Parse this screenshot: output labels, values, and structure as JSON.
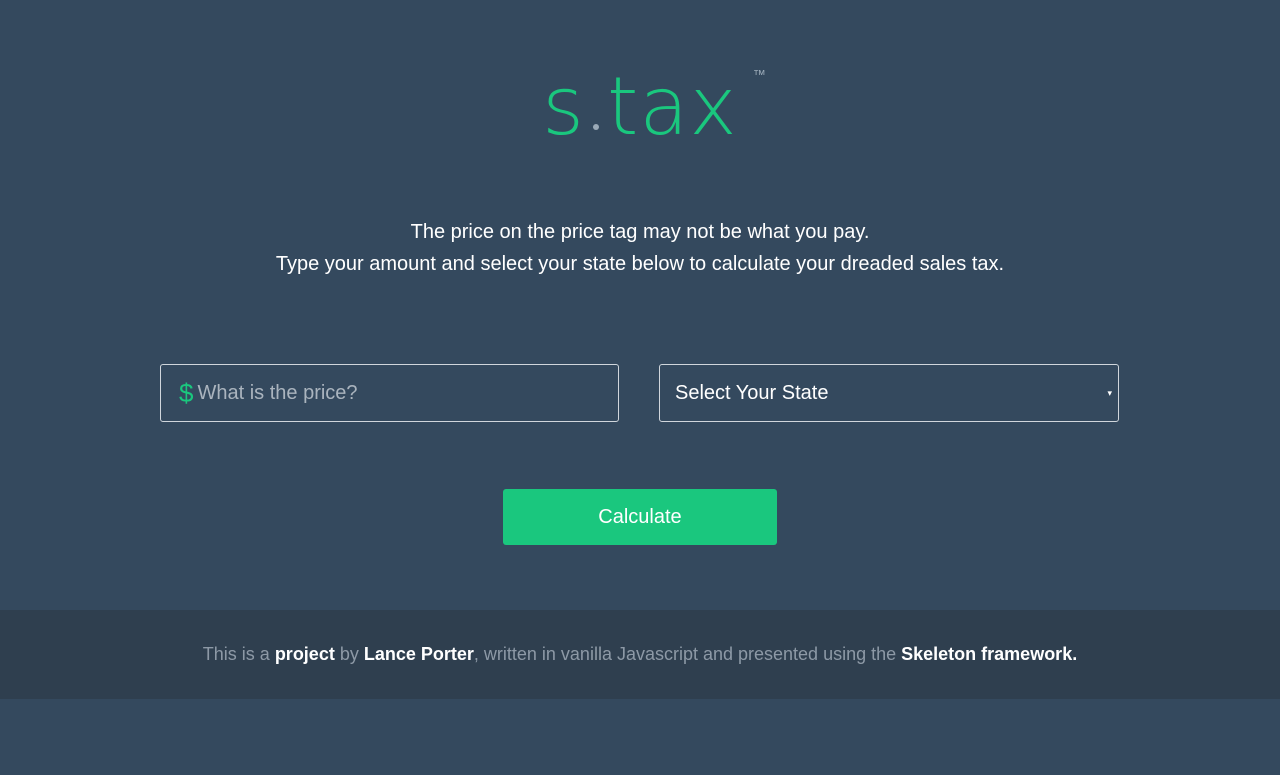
{
  "logo": {
    "left": "s",
    "right": "tax",
    "trademark": "™"
  },
  "tagline": {
    "line1": "The price on the price tag may not be what you pay.",
    "line2": "Type your amount and select your state below to calculate your dreaded sales tax."
  },
  "price_field": {
    "icon": "$",
    "placeholder": "What is the price?",
    "value": ""
  },
  "state_select": {
    "selected": "Select Your State",
    "caret": "▾"
  },
  "calculate_button": {
    "label": "Calculate"
  },
  "footer": {
    "text1": "This is a ",
    "link1": "project",
    "text2": " by ",
    "link2": "Lance Porter",
    "text3": ", written in vanilla Javascript and presented using the ",
    "link3": "Skeleton framework."
  },
  "colors": {
    "background": "#34495e",
    "accent": "#1ac77e",
    "footer_background": "#2f3f4f"
  }
}
